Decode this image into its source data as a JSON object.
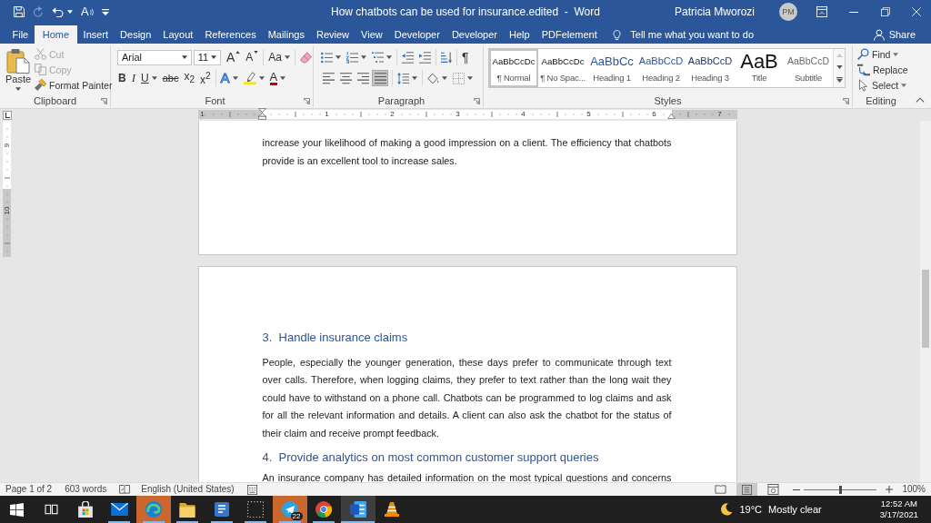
{
  "title_bar": {
    "quick_access": [
      {
        "kind": "save",
        "disabled": false
      },
      {
        "kind": "redo",
        "disabled": true
      },
      {
        "kind": "undo",
        "disabled": false,
        "dropdown": true
      },
      {
        "kind": "read_aloud",
        "glyph": "A",
        "disabled": false
      },
      {
        "kind": "customize",
        "disabled": false
      }
    ],
    "title": "How chatbots can be used for insurance.edited  -  Word",
    "user": "Patricia Mworozi",
    "avatar": "PM"
  },
  "tabs": [
    {
      "label": "File",
      "selected": false
    },
    {
      "label": "Home",
      "selected": true
    },
    {
      "label": "Insert",
      "selected": false
    },
    {
      "label": "Design",
      "selected": false
    },
    {
      "label": "Layout",
      "selected": false
    },
    {
      "label": "References",
      "selected": false
    },
    {
      "label": "Mailings",
      "selected": false
    },
    {
      "label": "Review",
      "selected": false
    },
    {
      "label": "View",
      "selected": false
    },
    {
      "label": "Developer",
      "selected": false
    },
    {
      "label": "Developer",
      "selected": false
    },
    {
      "label": "Help",
      "selected": false
    },
    {
      "label": "PDFelement",
      "selected": false
    }
  ],
  "tell_me": "Tell me what you want to do",
  "share": "Share",
  "ribbon": {
    "clipboard": {
      "title": "Clipboard",
      "paste": "Paste",
      "commands": [
        {
          "kind": "cut",
          "label": "Cut",
          "disabled": true
        },
        {
          "kind": "copy",
          "label": "Copy",
          "disabled": true
        },
        {
          "kind": "format_painter",
          "label": "Format Painter",
          "disabled": false
        }
      ]
    },
    "font": {
      "title": "Font",
      "font_name": "Arial",
      "font_size": "11",
      "row_1": [
        [
          {
            "kind": "grow",
            "glyph": "A"
          },
          {
            "kind": "shrink",
            "glyph": "A"
          }
        ],
        [
          {
            "kind": "change_case",
            "glyph": "Aa",
            "dropdown": true
          }
        ],
        [
          {
            "kind": "clear_formatting"
          }
        ]
      ],
      "row_2": [
        [
          {
            "kind": "bold",
            "glyph": "B"
          },
          {
            "kind": "italic",
            "glyph": "I"
          },
          {
            "kind": "underline",
            "glyph": "U",
            "dropdown": true
          },
          {
            "kind": "strikethrough",
            "glyph": "abc"
          },
          {
            "kind": "subscript",
            "glyph": "x$_{2}$"
          },
          {
            "kind": "superscript",
            "glyph": "x$^{2}$"
          }
        ],
        [
          {
            "kind": "text_effects",
            "glyph": "A",
            "dropdown": true
          },
          {
            "kind": "highlight",
            "dropdown": true
          },
          {
            "kind": "font_color",
            "glyph": "A",
            "dropdown": true
          }
        ]
      ]
    },
    "paragraph": {
      "title": "Paragraph",
      "row_1": [
        [
          {
            "kind": "bullets",
            "dropdown": true
          },
          {
            "kind": "numbering",
            "dropdown": true
          },
          {
            "kind": "multilevel",
            "dropdown": true
          }
        ],
        [
          {
            "kind": "decrease_indent"
          },
          {
            "kind": "increase_indent"
          }
        ],
        [
          {
            "kind": "sort"
          }
        ],
        [
          {
            "kind": "show_marks",
            "glyph": "¶"
          }
        ]
      ],
      "alignment": [
        {
          "kind": "align_left",
          "selected": false
        },
        {
          "kind": "center",
          "selected": false
        },
        {
          "kind": "align_right",
          "selected": false
        },
        {
          "kind": "justify",
          "selected": true
        }
      ],
      "row_2": [
        [
          {
            "kind": "line_spacing",
            "dropdown": true
          }
        ],
        [
          {
            "kind": "shading",
            "dropdown": true
          },
          {
            "kind": "borders",
            "dropdown": true
          }
        ]
      ]
    },
    "styles": {
      "title": "Styles",
      "gallery": [
        {
          "kind": "normal",
          "preview": "AaBbCcDc",
          "name": "¶ Normal",
          "selected": true
        },
        {
          "kind": "no_spacing",
          "preview": "AaBbCcDc",
          "name": "¶ No Spac...",
          "selected": false
        },
        {
          "kind": "heading_1",
          "preview": "AaBbCc",
          "name": "Heading 1",
          "selected": false
        },
        {
          "kind": "heading_2",
          "preview": "AaBbCcD",
          "name": "Heading 2",
          "selected": false
        },
        {
          "kind": "heading_3",
          "preview": "AaBbCcD",
          "name": "Heading 3",
          "selected": false
        },
        {
          "kind": "title",
          "preview": "AaB",
          "name": "Title",
          "selected": false
        },
        {
          "kind": "subtitle",
          "preview": "AaBbCcD",
          "name": "Subtitle",
          "selected": false
        }
      ]
    },
    "editing": {
      "title": "Editing",
      "commands": [
        {
          "kind": "find",
          "label": "Find",
          "dropdown": true
        },
        {
          "kind": "replace",
          "label": "Replace"
        },
        {
          "kind": "select",
          "label": "Select",
          "dropdown": true
        }
      ]
    }
  },
  "ruler": {
    "numbers": [
      "1",
      "1",
      "2",
      "3",
      "4",
      "5",
      "6",
      "7"
    ]
  },
  "vertical_ruler": {
    "numbers": [
      "9",
      "10"
    ]
  },
  "pages": [
    {
      "blocks": [
        {
          "kind": "paragraph",
          "text": "increase your likelihood of making a good impression on a client. The efficiency that chatbots provide is an excellent tool to increase sales."
        }
      ]
    },
    {
      "blocks": [
        {
          "kind": "heading",
          "text": "3.  Handle insurance claims"
        },
        {
          "kind": "paragraph",
          "text": "People, especially the younger generation, these days prefer to communicate through text over calls. Therefore, when logging claims, they prefer to text rather than the long wait they could have to withstand on a phone call. Chatbots can be programmed to log claims and ask for all the relevant information and details. A client can also ask the chatbot for the status of their claim and receive prompt feedback."
        },
        {
          "kind": "heading",
          "text": "4.  Provide analytics on most common customer support queries"
        },
        {
          "kind": "paragraph",
          "text": "An insurance company has detailed information on the most typical questions and concerns"
        }
      ]
    }
  ],
  "status_bar": {
    "page": "Page 1 of 2",
    "words": "603 words",
    "language": "English (United States)",
    "views": [
      {
        "kind": "read_mode",
        "selected": false
      },
      {
        "kind": "print_layout",
        "selected": true
      },
      {
        "kind": "web_layout",
        "selected": false
      }
    ],
    "zoom": {
      "level": 0.5,
      "percent": "100%"
    }
  },
  "taskbar": {
    "apps": [
      {
        "kind": "start",
        "running": false,
        "flashing": false,
        "active": false
      },
      {
        "kind": "task_view",
        "running": false,
        "flashing": false,
        "active": false
      },
      {
        "kind": "store",
        "running": false,
        "flashing": false,
        "active": false
      },
      {
        "kind": "mail",
        "running": true,
        "flashing": false,
        "active": false
      },
      {
        "kind": "edge",
        "running": true,
        "flashing": true,
        "active": false
      },
      {
        "kind": "explorer",
        "running": true,
        "flashing": false,
        "active": false
      },
      {
        "kind": "app_tile",
        "running": true,
        "flashing": false,
        "active": false
      },
      {
        "kind": "dotted",
        "running": true,
        "flashing": false,
        "active": false
      },
      {
        "kind": "messenger",
        "running": true,
        "flashing": true,
        "active": false,
        "badge": "22"
      },
      {
        "kind": "browser",
        "running": true,
        "flashing": false,
        "active": false
      },
      {
        "kind": "word",
        "running": true,
        "flashing": false,
        "active": true
      },
      {
        "kind": "player",
        "running": false,
        "flashing": false,
        "active": false
      }
    ],
    "weather": {
      "temperature": "19°C",
      "condition": "Mostly clear"
    },
    "clock": {
      "time": "12:52 AM",
      "date": "3/17/2021"
    }
  }
}
